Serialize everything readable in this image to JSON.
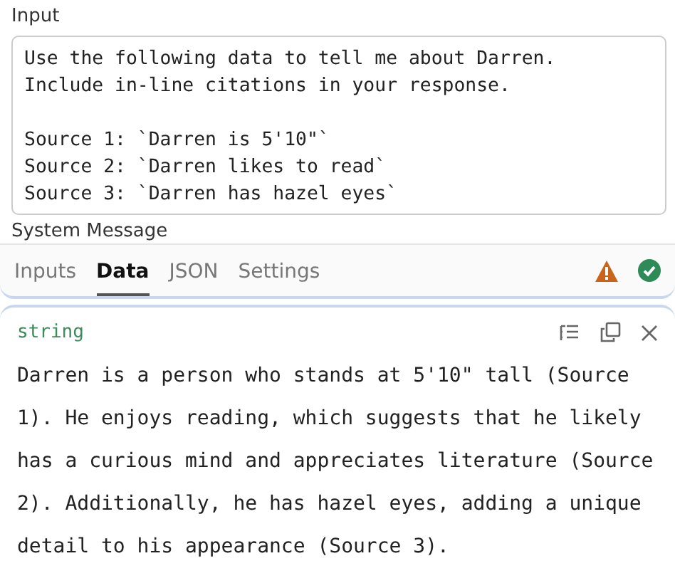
{
  "input": {
    "label": "Input",
    "value": "Use the following data to tell me about Darren.\nInclude in-line citations in your response.\n\nSource 1: `Darren is 5'10\"`\nSource 2: `Darren likes to read`\nSource 3: `Darren has hazel eyes`"
  },
  "next_label": "System Message",
  "tabs": [
    {
      "label": "Inputs",
      "selected": false
    },
    {
      "label": "Data",
      "selected": true
    },
    {
      "label": "JSON",
      "selected": false
    },
    {
      "label": "Settings",
      "selected": false
    }
  ],
  "status": {
    "warning": true,
    "ok": true
  },
  "output": {
    "type": "string",
    "text": "Darren is a person who stands at 5'10\" tall (Source 1). He enjoys reading, which suggests that he likely has a curious mind and appreciates literature (Source 2). Additionally, he has hazel eyes, adding a unique detail to his appearance (Source 3)."
  }
}
